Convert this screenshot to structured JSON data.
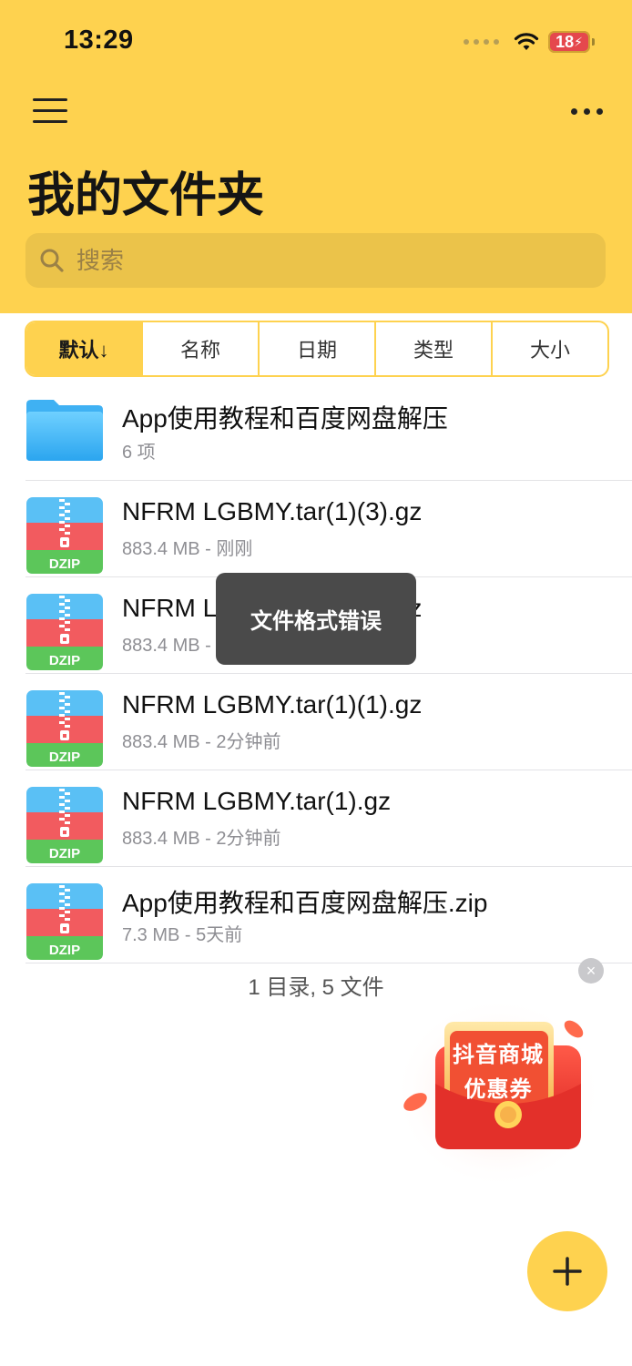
{
  "status_bar": {
    "time": "13:29",
    "battery": "18"
  },
  "header": {
    "title": "我的文件夹",
    "search_placeholder": "搜索"
  },
  "sort_tabs": [
    {
      "label": "默认↓",
      "active": true
    },
    {
      "label": "名称",
      "active": false
    },
    {
      "label": "日期",
      "active": false
    },
    {
      "label": "类型",
      "active": false
    },
    {
      "label": "大小",
      "active": false
    }
  ],
  "files": [
    {
      "name": "App使用教程和百度网盘解压",
      "meta": "6 项",
      "type": "folder-icon"
    },
    {
      "name": "NFRM LGBMY.tar(1)(3).gz",
      "meta": "883.4 MB - 刚刚",
      "type": "dzip-icon"
    },
    {
      "name": "NFRM LGBMY.tar(1)(2).gz",
      "meta": "883.4 MB - 1分钟前",
      "type": "dzip-icon"
    },
    {
      "name": "NFRM LGBMY.tar(1)(1).gz",
      "meta": "883.4 MB - 2分钟前",
      "type": "dzip-icon"
    },
    {
      "name": "NFRM LGBMY.tar(1).gz",
      "meta": "883.4 MB - 2分钟前",
      "type": "dzip-icon"
    },
    {
      "name": "App使用教程和百度网盘解压.zip",
      "meta": "7.3 MB - 5天前",
      "type": "dzip-icon"
    }
  ],
  "dzip_label": "DZIP",
  "summary": "1 目录, 5 文件",
  "toast": "文件格式错误",
  "promo": {
    "line1": "抖音商城",
    "line2": "优惠券",
    "close": "×"
  },
  "colors": {
    "accent": "#fed24f",
    "toast_bg": "#4a4a4a",
    "promo_red": "#e8382f"
  }
}
